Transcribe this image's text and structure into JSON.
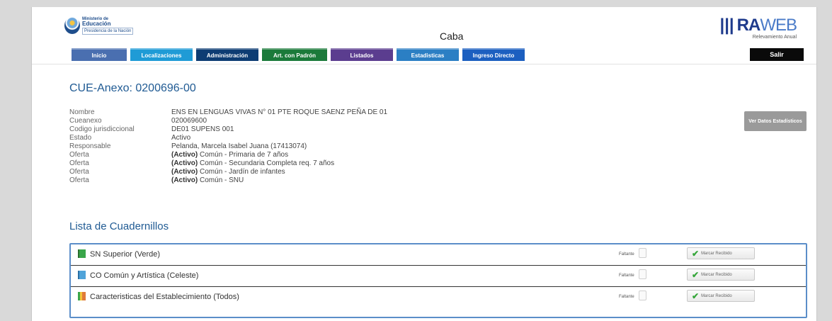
{
  "header": {
    "logo_line1": "Ministerio de",
    "logo_line2": "Educación",
    "logo_line3": "Presidencia de la Nación",
    "region": "Caba",
    "ra_bars": "|||",
    "ra_main": "RA",
    "ra_web": "WEB",
    "ra_sub": "Relevamiento Anual"
  },
  "nav": {
    "tabs": [
      {
        "label": "Inicio",
        "color": "#4a6fb0"
      },
      {
        "label": "Localizaciones",
        "color": "#1f9bd6"
      },
      {
        "label": "Administración",
        "color": "#0d3c73"
      },
      {
        "label": "Art. con Padrón",
        "color": "#1b7a3a"
      },
      {
        "label": "Listados",
        "color": "#5b3d8f"
      },
      {
        "label": "Estadisticas",
        "color": "#2b7fc4"
      },
      {
        "label": "Ingreso Directo",
        "color": "#1c5fc0"
      }
    ],
    "logout": "Salir"
  },
  "cue": {
    "title": "CUE-Anexo: 0200696-00",
    "rows": [
      {
        "label": "Nombre",
        "status": "",
        "value": "ENS EN LENGUAS VIVAS N° 01 PTE ROQUE SAENZ PEÑA DE 01"
      },
      {
        "label": "Cueanexo",
        "status": "",
        "value": "020069600"
      },
      {
        "label": "Codigo jurisdiccional",
        "status": "",
        "value": "DE01 SUPENS 001"
      },
      {
        "label": "Estado",
        "status": "",
        "value": "Activo"
      },
      {
        "label": "Responsable",
        "status": "",
        "value": "Pelanda, Marcela Isabel Juana (17413074)"
      },
      {
        "label": "Oferta",
        "status": "(Activo)",
        "value": " Común - Primaria de 7 años"
      },
      {
        "label": "Oferta",
        "status": "(Activo)",
        "value": " Común - Secundaria Completa req. 7 años"
      },
      {
        "label": "Oferta",
        "status": "(Activo)",
        "value": " Común - Jardín de infantes"
      },
      {
        "label": "Oferta",
        "status": "(Activo)",
        "value": " Común - SNU"
      }
    ],
    "stats_button": "Ver Datos Estadísticos"
  },
  "cuadernillos": {
    "title": "Lista de Cuadernillos",
    "rows": [
      {
        "label": "SN Superior (Verde)",
        "icon_color": "#3aa64a",
        "missing_label": "Faltante",
        "button": "Marcar Recibido"
      },
      {
        "label": "CO Común y Artística (Celeste)",
        "icon_color": "#4fa3d9",
        "missing_label": "Faltante",
        "button": "Marcar Recibido"
      },
      {
        "label": "Caracteristicas del Establecimiento (Todos)",
        "icon_color": "#e07a3a",
        "missing_label": "Faltante",
        "button": "Marcar Recibido"
      }
    ]
  }
}
